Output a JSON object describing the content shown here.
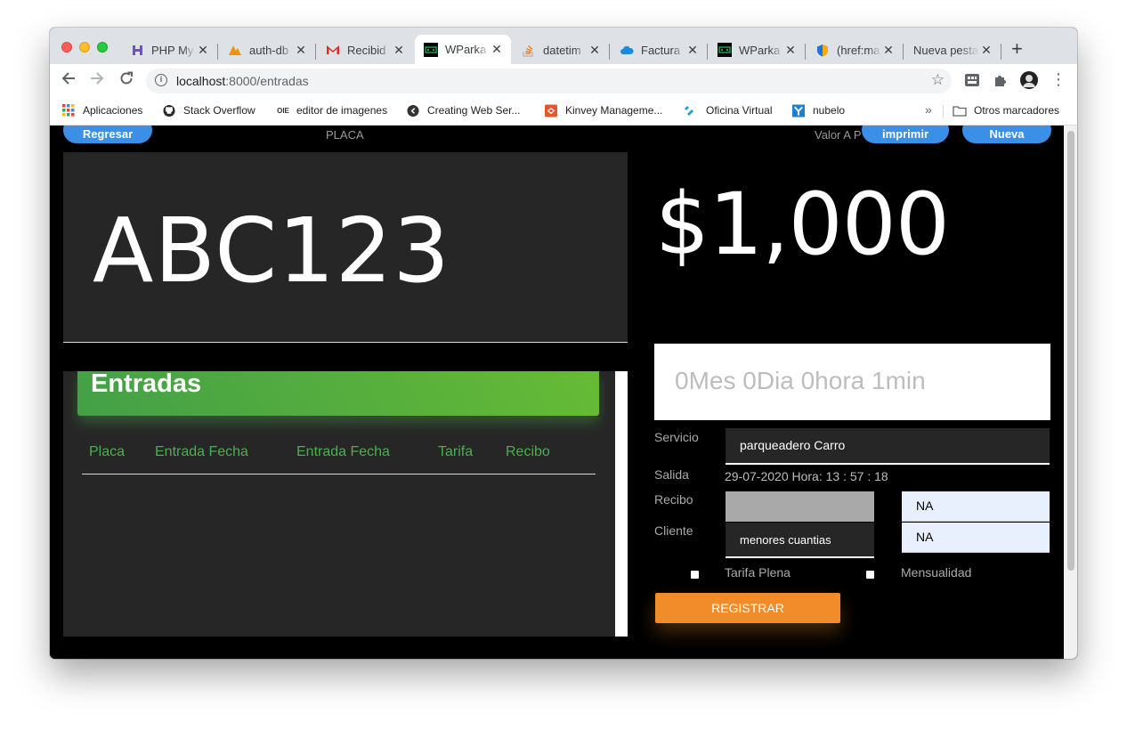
{
  "browser": {
    "tabs": [
      {
        "title": "PHP My",
        "icon": "phpmyadmin-icon",
        "icon_color": "#6c4fd3",
        "active": false
      },
      {
        "title": "auth-db",
        "icon": "pma-icon",
        "icon_color": "#f29111",
        "active": false
      },
      {
        "title": "Recibid",
        "icon": "gmail-icon",
        "icon_color": "#d93025",
        "active": false
      },
      {
        "title": "WParka",
        "icon": "wparking-icon",
        "icon_color": "#1e9e4a",
        "active": true
      },
      {
        "title": "datetim",
        "icon": "stackoverflow-icon",
        "icon_color": "#f48024",
        "active": false
      },
      {
        "title": "Factura",
        "icon": "cloud-icon",
        "icon_color": "#1f8ad9",
        "active": false
      },
      {
        "title": "WParka",
        "icon": "wparking-icon",
        "icon_color": "#1e9e4a",
        "active": false
      },
      {
        "title": "(href:ma",
        "icon": "shield-icon",
        "icon_color": "#1a73e8",
        "active": false
      },
      {
        "title": "Nueva pesta",
        "icon": "",
        "icon_color": "",
        "active": false
      }
    ],
    "url_host": "localhost",
    "url_path": ":8000/entradas",
    "bookmarks": [
      {
        "label": "Aplicaciones",
        "icon": "apps-grid-icon"
      },
      {
        "label": "Stack Overflow",
        "icon": "stackoverflow-icon"
      },
      {
        "label": "editor de imagenes",
        "icon": "oie-icon",
        "icon_text": "OIE"
      },
      {
        "label": "Creating Web Ser...",
        "icon": "s-circle-icon"
      },
      {
        "label": "Kinvey Manageme...",
        "icon": "kinvey-icon"
      },
      {
        "label": "Oficina Virtual",
        "icon": "oficina-icon"
      },
      {
        "label": "nubelo",
        "icon": "nubelo-icon"
      }
    ],
    "overflow_label": "»",
    "other_bookmarks": "Otros marcadores"
  },
  "page": {
    "back_button": "Regresar",
    "placa_label": "PLACA",
    "valor_label": "Valor A P",
    "print_button": "imprimir",
    "new_button": "Nueva",
    "plate": "ABC123",
    "price": "$1,000",
    "duration": "0Mes 0Dia 0hora 1min",
    "entries": {
      "title": "Entradas",
      "columns": [
        "Placa",
        "Entrada Fecha",
        "Entrada Fecha",
        "Tarifa",
        "Recibo"
      ],
      "rows": []
    },
    "form": {
      "servicio_label": "Servicio",
      "servicio_value": "parqueadero Carro",
      "salida_label": "Salida",
      "salida_value": "29-07-2020 Hora: 13 : 57 : 18",
      "recibo_label": "Recibo",
      "recibo_value": "",
      "recibo_extra": "NA",
      "cliente_label": "Cliente",
      "cliente_value": "menores cuantias",
      "cliente_extra": "NA",
      "tarifa_plena_label": "Tarifa Plena",
      "mensualidad_label": "Mensualidad",
      "register_button": "REGISTRAR"
    }
  },
  "colors": {
    "accent_blue": "#3b8fe6",
    "header_green": "#4caf50",
    "register_orange": "#f08c2a",
    "page_bg": "#000000",
    "card_bg": "#262626"
  }
}
